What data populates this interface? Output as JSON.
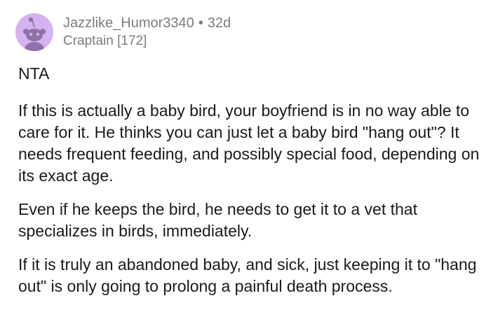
{
  "comment": {
    "author": "Jazzlike_Humor3340",
    "separator": "•",
    "age": "32d",
    "flair": "Craptain [172]",
    "avatar_bg": "#d4b3f0",
    "paragraphs": [
      "NTA",
      "If this is actually a baby bird, your boyfriend is in no way able to care for it.  He thinks you can just let a baby bird \"hang out\"?  It needs frequent feeding, and possibly special food, depending on its exact age.",
      "Even if he keeps the bird, he needs to get it to a vet that specializes in birds, immediately.",
      "If it is truly an abandoned baby, and sick, just keeping it to \"hang out\" is only going to prolong a painful death process."
    ]
  }
}
